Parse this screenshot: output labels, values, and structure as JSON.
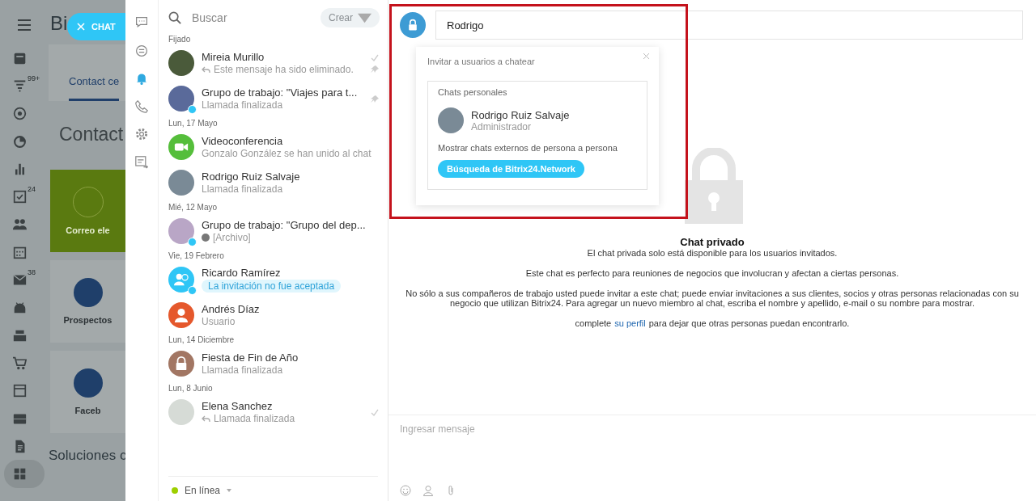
{
  "background": {
    "logo": "Bi",
    "chat_button": "CHAT",
    "tab": "Contact ce",
    "heading": "Contact",
    "section": "Soluciones c",
    "nav_items": [
      {
        "selected": false
      },
      {
        "selected": false,
        "badge": "99+"
      },
      {
        "selected": false
      },
      {
        "selected": false
      },
      {
        "selected": false
      },
      {
        "selected": false,
        "badge": "24"
      },
      {
        "selected": false
      },
      {
        "selected": false
      },
      {
        "selected": false,
        "badge": "38"
      },
      {
        "selected": false
      },
      {
        "selected": false
      },
      {
        "selected": false
      },
      {
        "selected": false
      },
      {
        "selected": false
      },
      {
        "selected": false
      },
      {
        "selected": true
      }
    ],
    "tiles": [
      {
        "label": "Correo ele",
        "kind": "email"
      },
      {
        "label": "Prospectos",
        "kind": "form"
      },
      {
        "label": "Faceb",
        "kind": "facebook"
      }
    ]
  },
  "rail": [
    {
      "selected": false
    },
    {
      "selected": false
    },
    {
      "selected": true
    },
    {
      "selected": false
    },
    {
      "selected": false
    },
    {
      "selected": false
    }
  ],
  "chat_list": {
    "search": {
      "placeholder": "Buscar"
    },
    "create_button": "Crear",
    "status": "En línea",
    "groups": [
      {
        "label": "Fijado",
        "items": [
          {
            "name": "Mireia Murillo",
            "preview": {
              "text": "Este mensaje ha sido eliminado.",
              "kind": "reply"
            },
            "kind": "photo",
            "color": "#4a5a3a",
            "group": false,
            "pinned": true,
            "read": true
          },
          {
            "name": "Grupo de trabajo: \"Viajes para t...",
            "preview": {
              "text": "Llamada finalizada",
              "kind": "text"
            },
            "kind": "photo",
            "color": "#5a6a9a",
            "group": true,
            "pinned": true,
            "read": false
          }
        ]
      },
      {
        "label": "Lun, 17 Mayo",
        "items": [
          {
            "name": "Videoconferencia",
            "preview": {
              "text": "Gonzalo González se han unido al chat",
              "kind": "text"
            },
            "kind": "video",
            "color": "#55be3b",
            "group": false,
            "pinned": false,
            "read": false
          },
          {
            "name": "Rodrigo Ruiz Salvaje",
            "preview": {
              "text": "Llamada finalizada",
              "kind": "text"
            },
            "kind": "photo",
            "color": "#7a8a96",
            "group": false,
            "pinned": false,
            "read": false
          }
        ]
      },
      {
        "label": "Mié, 12 Mayo",
        "items": [
          {
            "name": "Grupo de trabajo: \"Grupo del dep...",
            "preview": {
              "text": "[Archivo]",
              "kind": "file"
            },
            "kind": "photo",
            "color": "#b9a6c6",
            "group": true,
            "pinned": false,
            "read": false
          }
        ]
      },
      {
        "label": "Vie, 19 Febrero",
        "items": [
          {
            "name": "Ricardo Ramírez",
            "preview": {
              "text": "La invitación no fue aceptada",
              "kind": "pill"
            },
            "kind": "invite",
            "color": "#2fc6f6",
            "group": true,
            "pinned": false,
            "read": false
          },
          {
            "name": "Andrés Díaz",
            "preview": {
              "text": "Usuario",
              "kind": "text"
            },
            "kind": "user",
            "color": "#e5582c",
            "group": false,
            "pinned": false,
            "read": false
          }
        ]
      },
      {
        "label": "Lun, 14 Diciembre",
        "items": [
          {
            "name": "Fiesta de Fin de Año",
            "preview": {
              "text": "Llamada finalizada",
              "kind": "text"
            },
            "kind": "lock",
            "color": "#a27663",
            "group": false,
            "pinned": false,
            "read": false
          }
        ]
      },
      {
        "label": "Lun, 8 Junio",
        "items": [
          {
            "name": "Elena Sanchez",
            "preview": {
              "text": "Llamada finalizada",
              "kind": "reply"
            },
            "kind": "photo",
            "color": "#d6dbd6",
            "group": false,
            "pinned": false,
            "read": true
          }
        ]
      }
    ]
  },
  "main": {
    "title_field": {
      "value": "Rodrigo"
    },
    "popup": {
      "title": "Invitar a usuarios a chatear",
      "section": "Chats personales",
      "result": {
        "name": "Rodrigo Ruiz Salvaje",
        "role": "Administrador"
      },
      "external_label": "Mostrar chats externos de persona a persona",
      "network_button": "Búsqueda de Bitrix24.Network"
    },
    "info": {
      "title": "Chat privado",
      "lines": [
        "El chat privada solo está disponible para los usuarios invitados.",
        "Este chat es perfecto para reuniones de negocios que involucran y afectan a ciertas personas.",
        "No sólo a sus compañeros de trabajo usted puede invitar a este chat; puede enviar invitaciones a sus clientes, socios y otras personas relacionadas con su negocio que utilizan Bitrix24. Para agregar un nuevo miembro al chat, escriba el nombre y apellido, e-mail o su nombre para mostrar."
      ],
      "profile_line": {
        "before": "complete",
        "link": "su perfil",
        "after": "para dejar que otras personas puedan encontrarlo."
      }
    },
    "composer": {
      "placeholder": "Ingresar mensaje"
    }
  }
}
